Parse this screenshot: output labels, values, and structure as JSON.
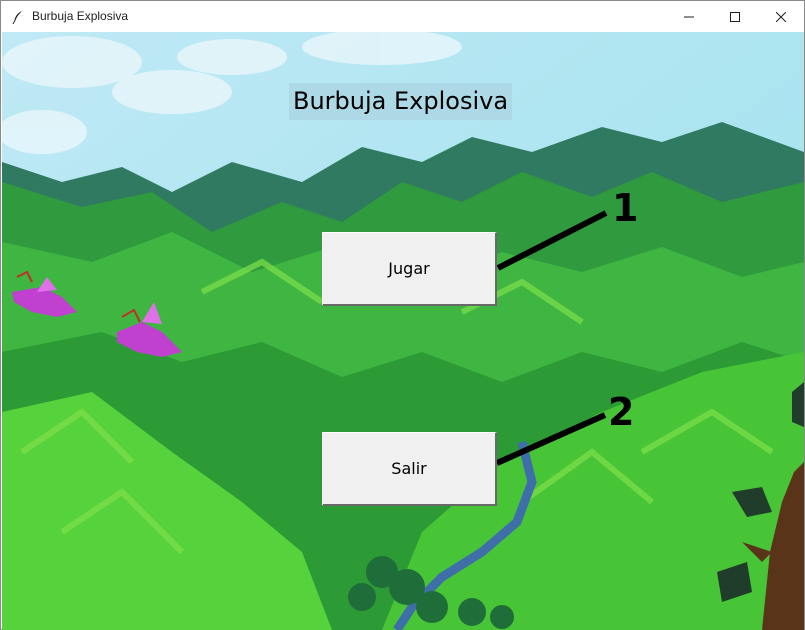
{
  "window": {
    "title": "Burbuja Explosiva",
    "icon": "feather-icon",
    "controls": [
      "minimize-icon",
      "maximize-icon",
      "close-icon"
    ]
  },
  "game": {
    "title": "Burbuja Explosiva",
    "buttons": {
      "play_label": "Jugar",
      "exit_label": "Salir"
    }
  },
  "annotations": {
    "first": "1",
    "second": "2"
  },
  "colors": {
    "title_background": "#add8e6",
    "button_face": "#f0f0f0",
    "sky": "#aee6f2",
    "mountains": "#2e8b3d",
    "annotation": "#000000"
  }
}
